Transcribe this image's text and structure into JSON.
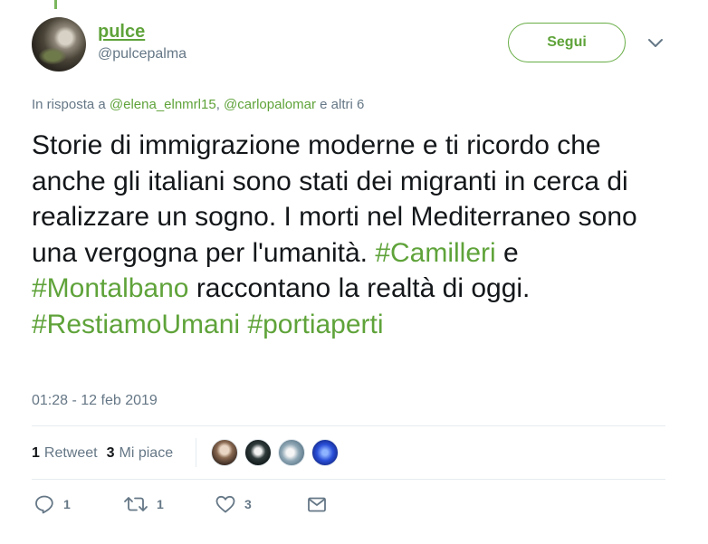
{
  "user": {
    "name": "pulce",
    "handle": "@pulcepalma"
  },
  "follow_label": "Segui",
  "reply": {
    "prefix": "In risposta a",
    "mention1": "@elena_elnmrl15",
    "sep": ",",
    "mention2": "@carlopalomar",
    "suffix": "e altri 6"
  },
  "tweet": {
    "t1": "Storie di immigrazione moderne e ti ricordo che anche gli italiani sono stati dei migranti in cerca di realizzare un sogno. I morti nel Mediterraneo sono una vergogna per l'umanità.",
    "h1": "#Camilleri",
    "t2": "e",
    "h2": "#Montalbano",
    "t3": "raccontano la realtà di oggi.",
    "h3": "#RestiamoUmani",
    "h4": "#portiaperti"
  },
  "timestamp": "01:28 - 12 feb 2019",
  "stats": {
    "retweets_count": "1",
    "retweets_label": "Retweet",
    "likes_count": "3",
    "likes_label": "Mi piace"
  },
  "actions": {
    "reply_count": "1",
    "retweet_count": "1",
    "like_count": "3"
  },
  "icons": [
    "chevron-down-icon",
    "reply-icon",
    "retweet-icon",
    "heart-icon",
    "message-icon"
  ],
  "colors": {
    "accent": "#5fa33a",
    "muted": "#657786",
    "text": "#14171a"
  }
}
